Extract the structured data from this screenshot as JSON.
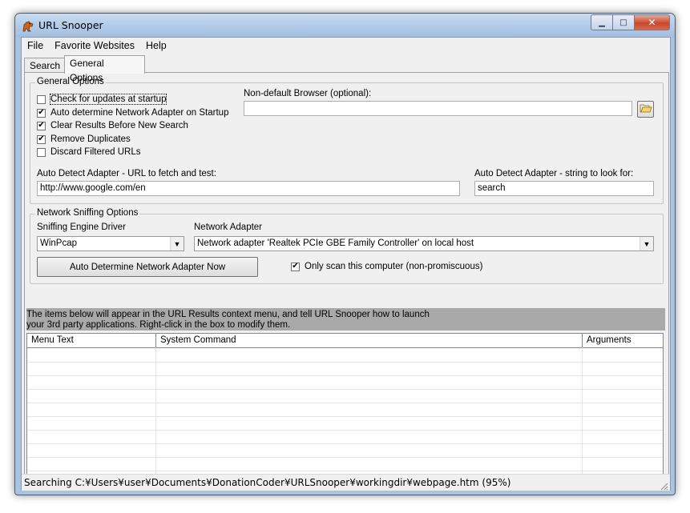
{
  "window": {
    "title": "URL Snooper",
    "icons": {
      "app": "dog-icon",
      "minimize": "minimize-icon",
      "maximize": "maximize-icon",
      "close": "close-icon"
    }
  },
  "menu": [
    "File",
    "Favorite Websites",
    "Help"
  ],
  "tabs": [
    {
      "label": "Search"
    },
    {
      "label": "General Options",
      "active": true
    }
  ],
  "general_options": {
    "group_title": "General Options",
    "checkboxes": [
      {
        "label": "Check for updates at startup",
        "checked": false
      },
      {
        "label": "Auto determine Network Adapter on Startup",
        "checked": true
      },
      {
        "label": "Clear Results Before New Search",
        "checked": true
      },
      {
        "label": "Remove Duplicates",
        "checked": true
      },
      {
        "label": "Discard Filtered URLs",
        "checked": false
      }
    ],
    "browser_label": "Non-default Browser (optional):",
    "browser_value": "",
    "browse_icon": "folder-open-icon",
    "url_label": "Auto Detect Adapter - URL to fetch and test:",
    "url_value": "http://www.google.com/en",
    "string_label": "Auto Detect Adapter - string to look for:",
    "string_value": "search"
  },
  "network": {
    "group_title": "Network Sniffing Options",
    "driver_label": "Sniffing Engine Driver",
    "driver_value": "WinPcap",
    "adapter_label": "Network Adapter",
    "adapter_value": "Network adapter 'Realtek PCIe GBE Family Controller' on local host",
    "detect_button": "Auto Determine Network Adapter Now",
    "local_only_label": "Only scan this computer (non-promiscuous)",
    "local_only_checked": true
  },
  "info": {
    "line1": "The items below will appear in the URL Results context menu, and tell URL Snooper how to launch",
    "line2": "your 3rd party applications.  Right-click in the box to modify them."
  },
  "grid": {
    "columns": [
      "Menu Text",
      "System Command",
      "Arguments"
    ],
    "rows": []
  },
  "status": {
    "text": "Searching C:¥Users¥user¥Documents¥DonationCoder¥URLSnooper¥workingdir¥webpage.htm (95%)"
  }
}
